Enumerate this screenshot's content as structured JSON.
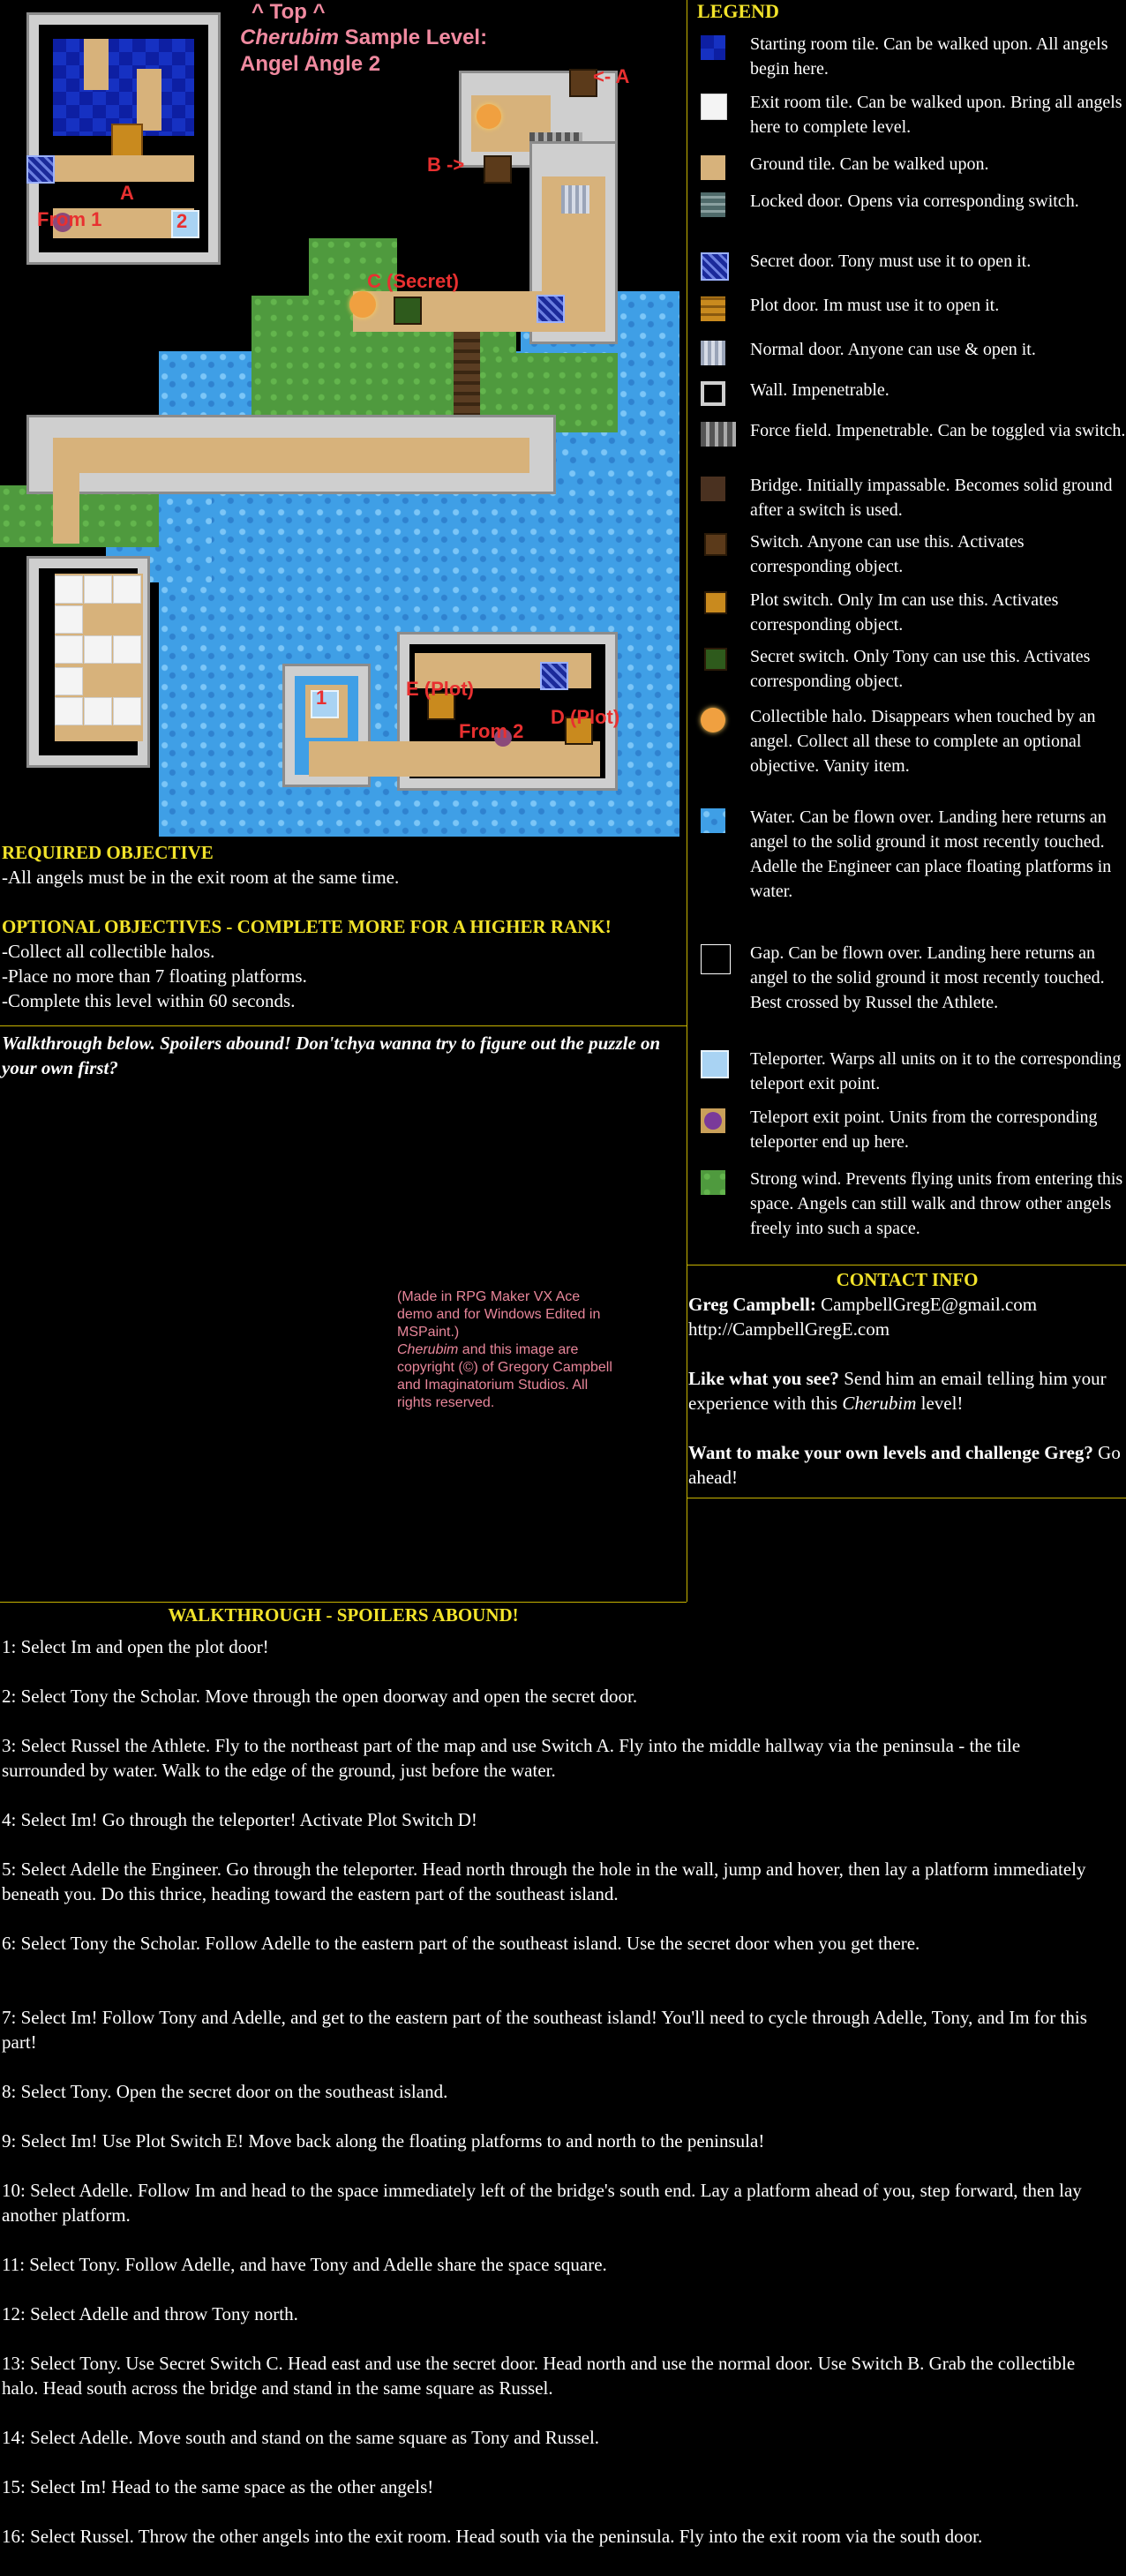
{
  "map": {
    "top_label": "^ Top ^",
    "title_italic": "Cherubim",
    "title_rest": " Sample Level:",
    "title_line2": "Angel Angle 2",
    "labels": {
      "a_arrow": "<- A",
      "b_arrow": "B ->",
      "a_small": "A",
      "from1": "From 1",
      "two": "2",
      "c_secret": "C (Secret)",
      "one": "1",
      "e_plot": "E (Plot)",
      "from2": "From 2",
      "d_plot": "D (Plot)"
    }
  },
  "legend": {
    "title": "LEGEND",
    "items": [
      {
        "icon": "starting-room-tile",
        "text": "Starting room tile.  Can be walked upon.  All angels begin here."
      },
      {
        "icon": "exit-room-tile",
        "text": "Exit room tile.  Can be walked upon.  Bring all angels here to complete level."
      },
      {
        "icon": "ground-tile",
        "text": "Ground tile.  Can be walked upon."
      },
      {
        "icon": "locked-door",
        "text": "Locked door.  Opens via corresponding switch."
      },
      {
        "icon": "secret-door",
        "text": "Secret door.  Tony must use it to open it."
      },
      {
        "icon": "plot-door",
        "text": "Plot door.  Im must use it to open it."
      },
      {
        "icon": "normal-door",
        "text": "Normal door.  Anyone can use & open it."
      },
      {
        "icon": "wall",
        "text": "Wall.  Impenetrable."
      },
      {
        "icon": "force-field",
        "text": "Force field.  Impenetrable.  Can be toggled via switch."
      },
      {
        "icon": "bridge",
        "text": "Bridge.  Initially impassable.  Becomes solid ground after a switch is used."
      },
      {
        "icon": "switch",
        "text": "Switch.  Anyone can use this.  Activates corresponding object."
      },
      {
        "icon": "plot-switch",
        "text": "Plot switch.  Only Im can use this.  Activates corresponding object."
      },
      {
        "icon": "secret-switch",
        "text": "Secret switch.  Only Tony can use this.  Activates corresponding object."
      },
      {
        "icon": "collectible-halo",
        "text": "Collectible halo.  Disappears when touched by an angel.  Collect all these to complete an optional objective.  Vanity item."
      },
      {
        "icon": "water",
        "text": "Water.  Can be flown over.  Landing here returns an angel to the solid ground it most recently touched.  Adelle the Engineer can place floating platforms in water."
      },
      {
        "icon": "gap",
        "text": "Gap.  Can be flown over.  Landing here returns an angel to the solid ground it most recently touched.  Best crossed by Russel the Athlete."
      },
      {
        "icon": "teleporter",
        "text": "Teleporter.  Warps all units on it to the corresponding teleport exit point."
      },
      {
        "icon": "teleport-exit",
        "text": "Teleport exit point.  Units from the corresponding teleporter end up here."
      },
      {
        "icon": "strong-wind",
        "text": "Strong wind.  Prevents flying units from entering this space.  Angels can still walk and throw other angels freely into such a space."
      }
    ]
  },
  "objectives": {
    "required_title": "REQUIRED OBJECTIVE",
    "required": [
      "-All angels must be in the exit room at the same time."
    ],
    "optional_title": "OPTIONAL OBJECTIVES - COMPLETE MORE FOR A HIGHER RANK!",
    "optional": [
      "-Collect all collectible halos.",
      "-Place no more than 7 floating platforms.",
      "-Complete this level within 60 seconds."
    ]
  },
  "spoiler_teaser": "Walkthrough below.  Spoilers abound!  Don'tchya wanna try to figure out the puzzle on your own first?",
  "credits": {
    "made_with": "(Made in RPG Maker VX Ace demo and for Windows Edited in MSPaint.)",
    "title_italic": "Cherubim",
    "copyright": " and this image are copyright (©) of Gregory Campbell and Imaginatorium Studios.  All rights reserved."
  },
  "contact": {
    "title": "CONTACT INFO",
    "name": "Greg Campbell:",
    "email": " CampbellGregE@gmail.com",
    "url": "http://CampbellGregE.com",
    "like_bold": "Like what you see?",
    "like_rest_1": "  Send him an email telling him your experience with this ",
    "like_italic": "Cherubim",
    "like_rest_2": " level!",
    "make_bold": "Want to make your own levels and challenge Greg?",
    "make_rest": "  Go ahead!"
  },
  "walkthrough": {
    "title": "WALKTHROUGH - SPOILERS ABOUND!",
    "steps": [
      "1: Select Im and open the plot door!",
      "2: Select Tony the Scholar.  Move through the open doorway and open the secret door.",
      "3: Select Russel the Athlete.  Fly to the northeast part of the map and use Switch A.  Fly into the middle hallway via the peninsula - the tile surrounded by water.  Walk to the edge of the ground, just before the water.",
      "4: Select Im!  Go through the teleporter!  Activate Plot Switch D!",
      "5: Select Adelle the Engineer.  Go through the teleporter.  Head north through the hole in the wall, jump and hover, then lay a platform immediately beneath you.  Do this thrice, heading toward the eastern part of the southeast island.",
      "6: Select Tony the Scholar.  Follow Adelle to the eastern part of the southeast island.  Use the secret door when you get there.",
      "7: Select Im!  Follow Tony and Adelle, and get to the eastern part of the southeast island!  You'll need to cycle through Adelle, Tony, and Im for this part!",
      "8: Select Tony.  Open the secret door on the southeast island.",
      "9: Select Im!  Use Plot Switch E!  Move back along the floating platforms to and north to the peninsula!",
      "10: Select Adelle.  Follow Im and head to the space immediately left of the bridge's south end.  Lay a platform ahead of you, step forward, then lay another platform.",
      "11: Select Tony.  Follow Adelle, and have Tony and Adelle share the space square.",
      "12: Select Adelle and throw Tony north.",
      "13: Select Tony.  Use Secret Switch C.  Head east and use the secret door.  Head north and use the normal door.  Use Switch B.  Grab the collectible halo.  Head south across the bridge and stand in the same square as Russel.",
      "14: Select Adelle.  Move south and stand on the same square as Tony and Russel.",
      "15: Select Im!  Head to the same space as the other angels!",
      "16: Select Russel.  Throw the other angels into the exit room.  Head south via the peninsula.  Fly into the exit room via the south door."
    ]
  }
}
